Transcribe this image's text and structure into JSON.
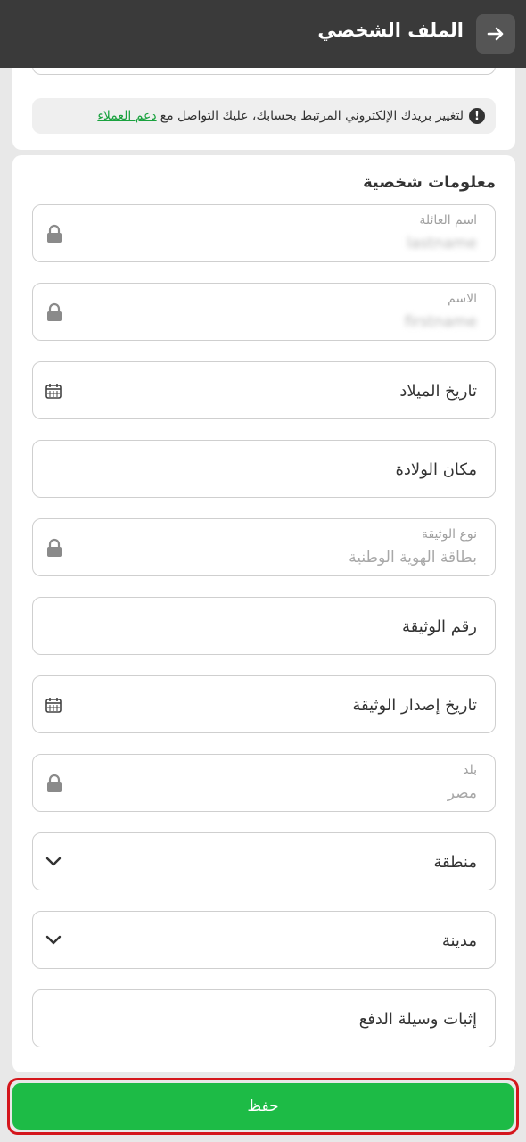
{
  "header": {
    "title": "الملف الشخصي"
  },
  "notice": {
    "text": "لتغيير بريدك الإلكتروني المرتبط بحسابك، عليك التواصل مع",
    "link": "دعم العملاء"
  },
  "personal": {
    "section_title": "معلومات شخصية",
    "last_name": {
      "label": "اسم العائلة",
      "value": "lastname"
    },
    "first_name": {
      "label": "الاسم",
      "value": "firstname"
    },
    "birth_date": {
      "placeholder": "تاريخ الميلاد"
    },
    "birth_place": {
      "placeholder": "مكان الولادة"
    },
    "document_type": {
      "label": "نوع الوثيقة",
      "value": "بطاقة الهوية الوطنية"
    },
    "document_number": {
      "placeholder": "رقم الوثيقة"
    },
    "document_issue_date": {
      "placeholder": "تاريخ إصدار الوثيقة"
    },
    "country": {
      "label": "بلد",
      "value": "مصر"
    },
    "region": {
      "placeholder": "منطقة"
    },
    "city": {
      "placeholder": "مدينة"
    },
    "payment_proof": {
      "placeholder": "إثبات وسيلة الدفع"
    }
  },
  "save_label": "حفظ"
}
